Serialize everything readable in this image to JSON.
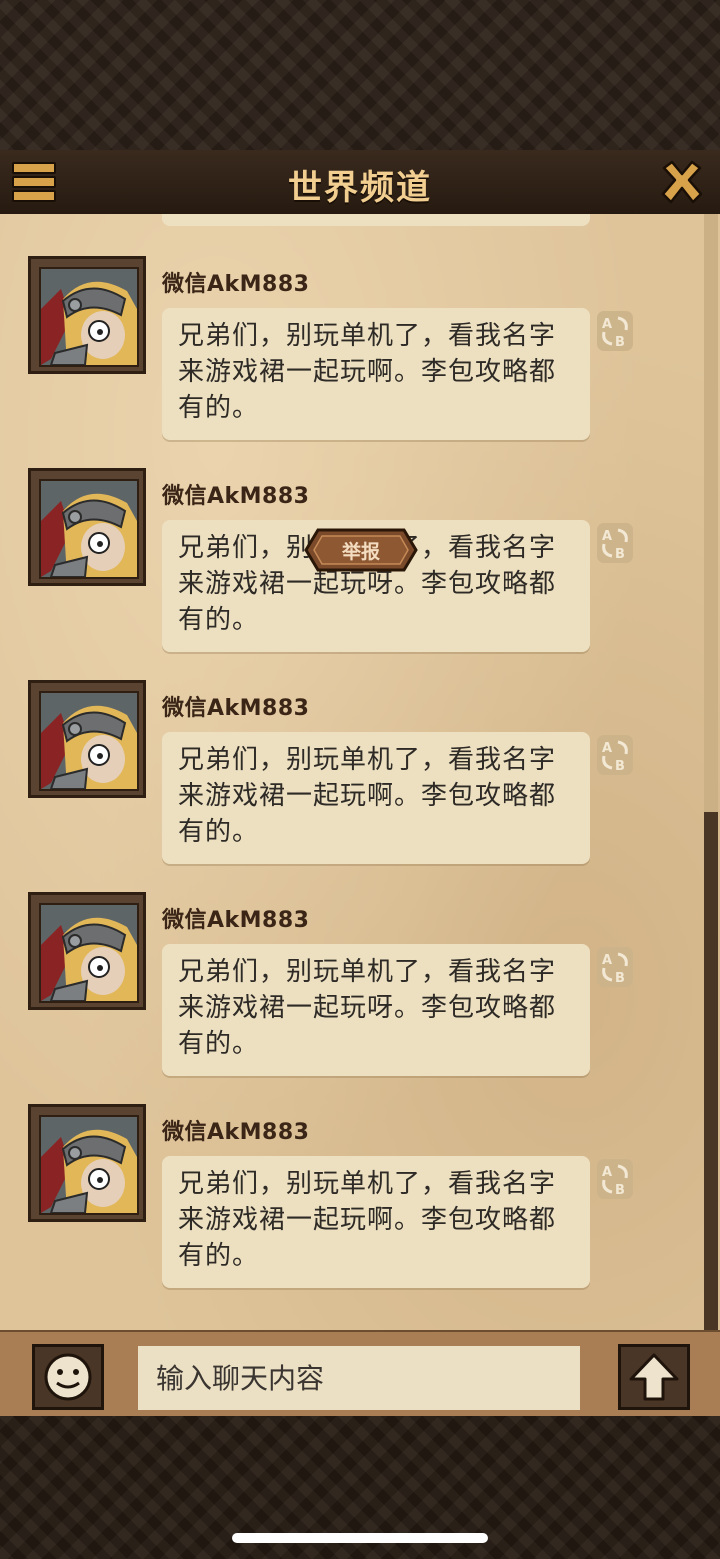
{
  "header": {
    "title": "世界频道"
  },
  "messages": [
    {
      "username": "微信AkM883",
      "text": "兄弟们，别玩单机了，看我名字来游戏裙一起玩啊。李包攻略都有的。"
    },
    {
      "username": "微信AkM883",
      "text": "兄弟们，别玩单机了，看我名字来游戏裙一起玩呀。李包攻略都有的。"
    },
    {
      "username": "微信AkM883",
      "text": "兄弟们，别玩单机了，看我名字来游戏裙一起玩啊。李包攻略都有的。"
    },
    {
      "username": "微信AkM883",
      "text": "兄弟们，别玩单机了，看我名字来游戏裙一起玩呀。李包攻略都有的。"
    },
    {
      "username": "微信AkM883",
      "text": "兄弟们，别玩单机了，看我名字来游戏裙一起玩啊。李包攻略都有的。"
    }
  ],
  "popup": {
    "report_label": "举报"
  },
  "input": {
    "placeholder": "输入聊天内容"
  },
  "icons": {
    "menu": "menu-icon",
    "close": "close-icon",
    "translate": "translate-icon",
    "emoji": "smiley-icon",
    "send": "up-arrow-icon"
  },
  "colors": {
    "header_bg": "#2b1e14",
    "title_text": "#f2cf90",
    "panel_bg": "#dfc49a",
    "bubble_bg": "#ede0c1",
    "username_text": "#3a2516",
    "report_bg": "#7a4a2a"
  }
}
